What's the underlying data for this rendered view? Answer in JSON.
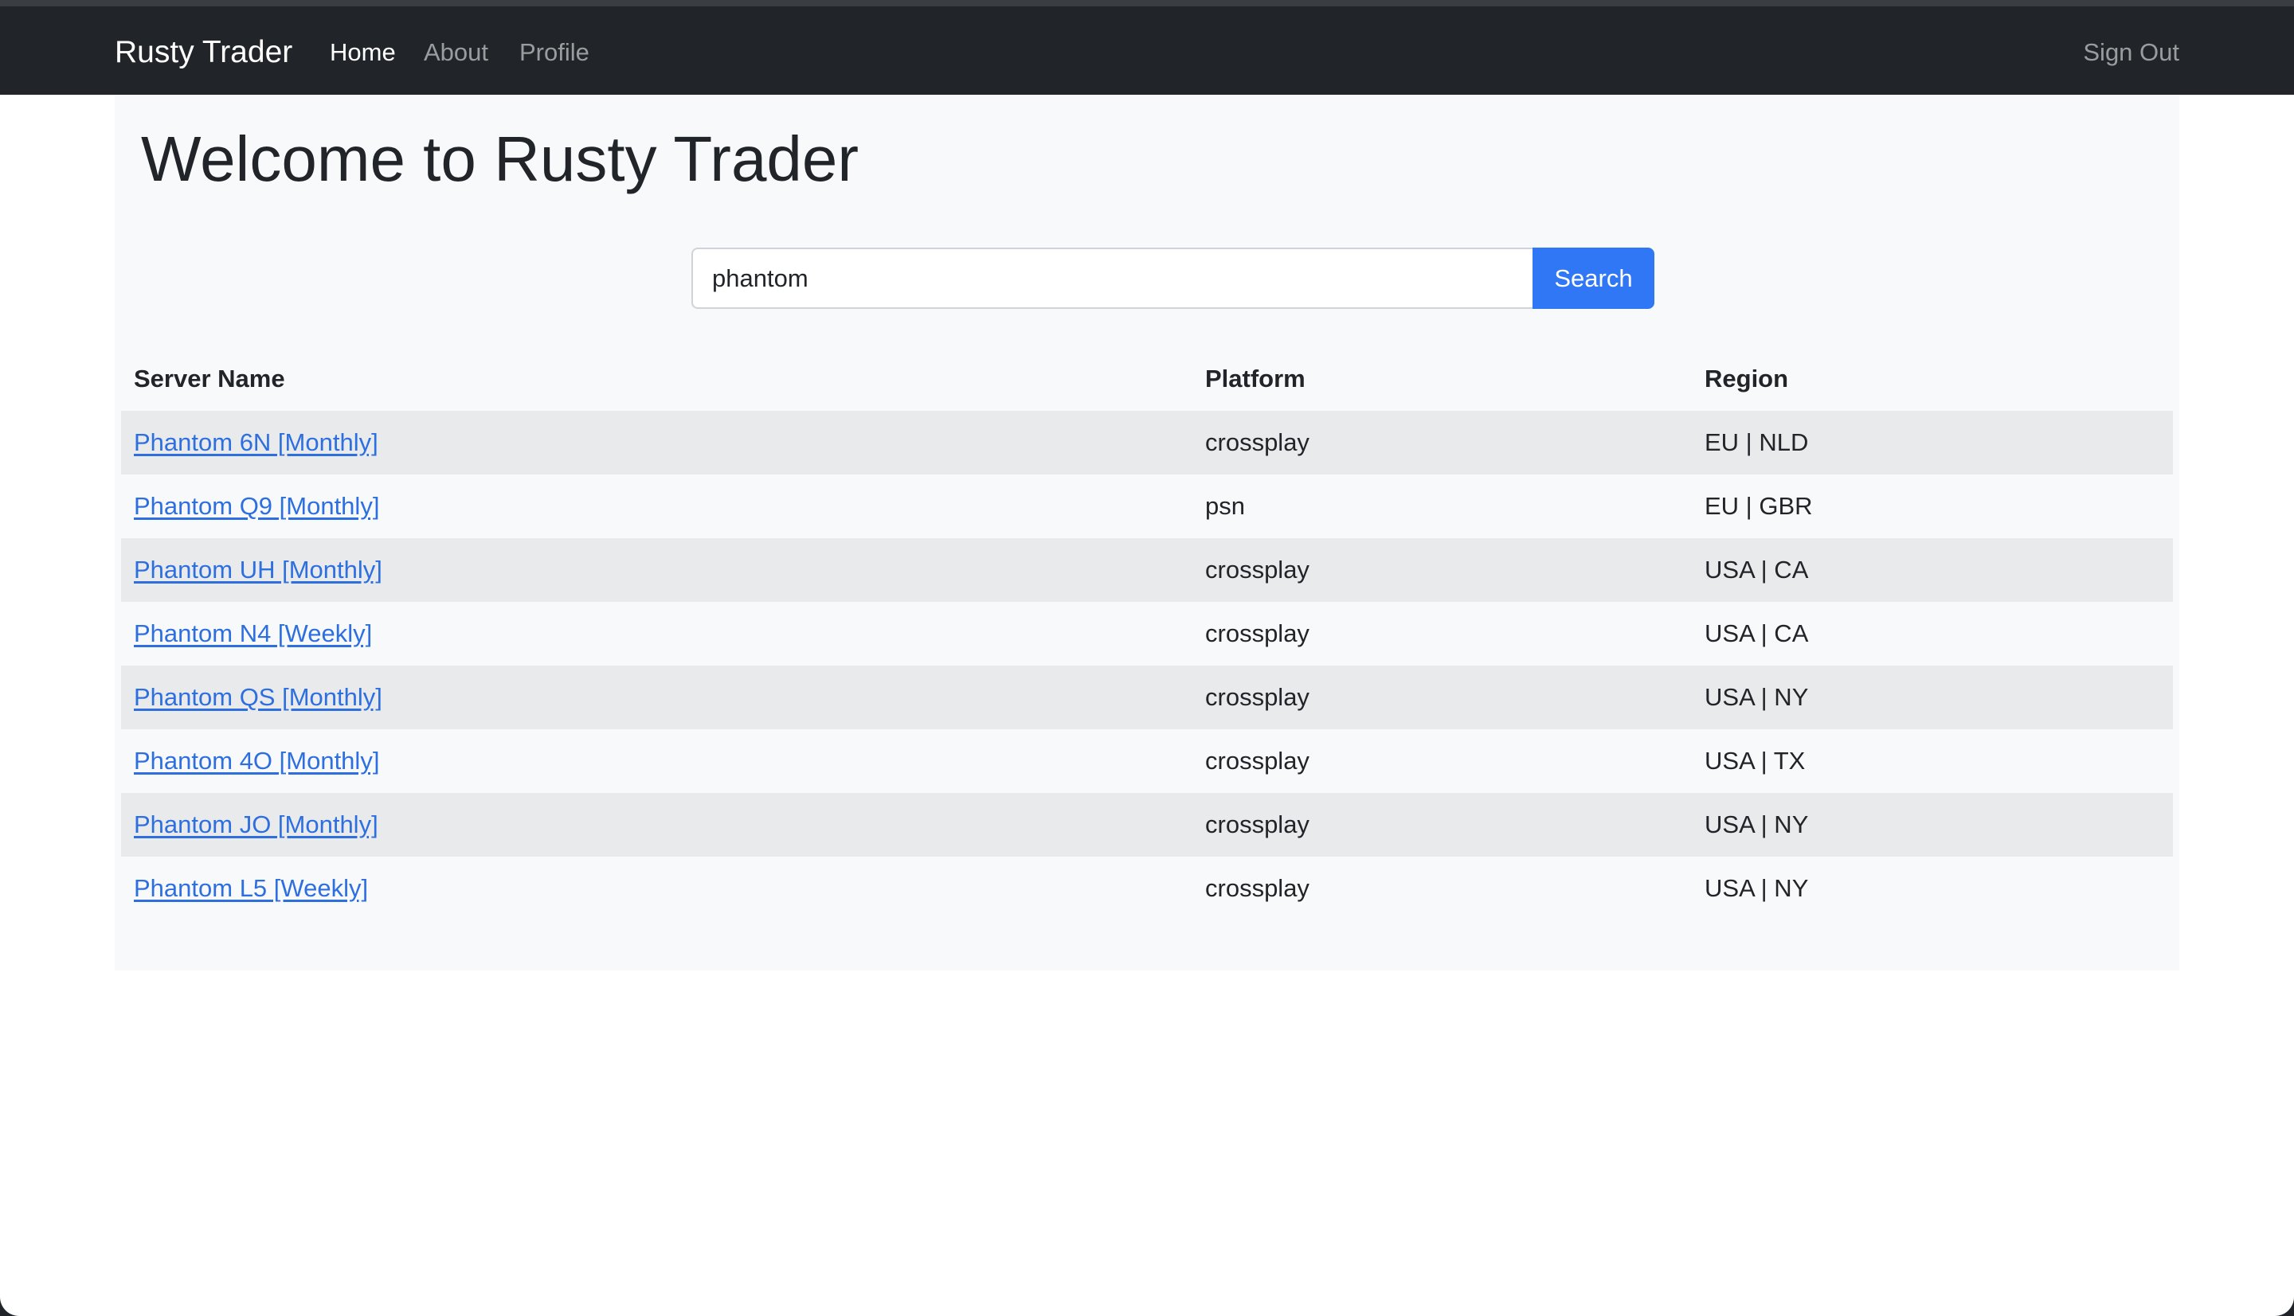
{
  "navbar": {
    "brand": "Rusty Trader",
    "links": [
      {
        "label": "Home",
        "active": true
      },
      {
        "label": "About",
        "active": false
      },
      {
        "label": "Profile",
        "active": false
      }
    ],
    "sign_out": "Sign Out"
  },
  "main": {
    "title": "Welcome to Rusty Trader",
    "search": {
      "value": "phantom",
      "button_label": "Search"
    },
    "table": {
      "headers": [
        "Server Name",
        "Platform",
        "Region"
      ],
      "rows": [
        {
          "name": "Phantom 6N [Monthly]",
          "platform": "crossplay",
          "region": "EU | NLD"
        },
        {
          "name": "Phantom Q9 [Monthly]",
          "platform": "psn",
          "region": "EU | GBR"
        },
        {
          "name": "Phantom UH [Monthly]",
          "platform": "crossplay",
          "region": "USA | CA"
        },
        {
          "name": "Phantom N4 [Weekly]",
          "platform": "crossplay",
          "region": "USA | CA"
        },
        {
          "name": "Phantom QS [Monthly]",
          "platform": "crossplay",
          "region": "USA | NY"
        },
        {
          "name": "Phantom 4O [Monthly]",
          "platform": "crossplay",
          "region": "USA | TX"
        },
        {
          "name": "Phantom JO [Monthly]",
          "platform": "crossplay",
          "region": "USA | NY"
        },
        {
          "name": "Phantom L5 [Weekly]",
          "platform": "crossplay",
          "region": "USA | NY"
        }
      ]
    }
  },
  "colors": {
    "navbar_bg": "#212529",
    "primary": "#2f77f4",
    "link": "#2e6fe0",
    "container_bg": "#f8f9fa",
    "stripe": "#e9eaec"
  }
}
